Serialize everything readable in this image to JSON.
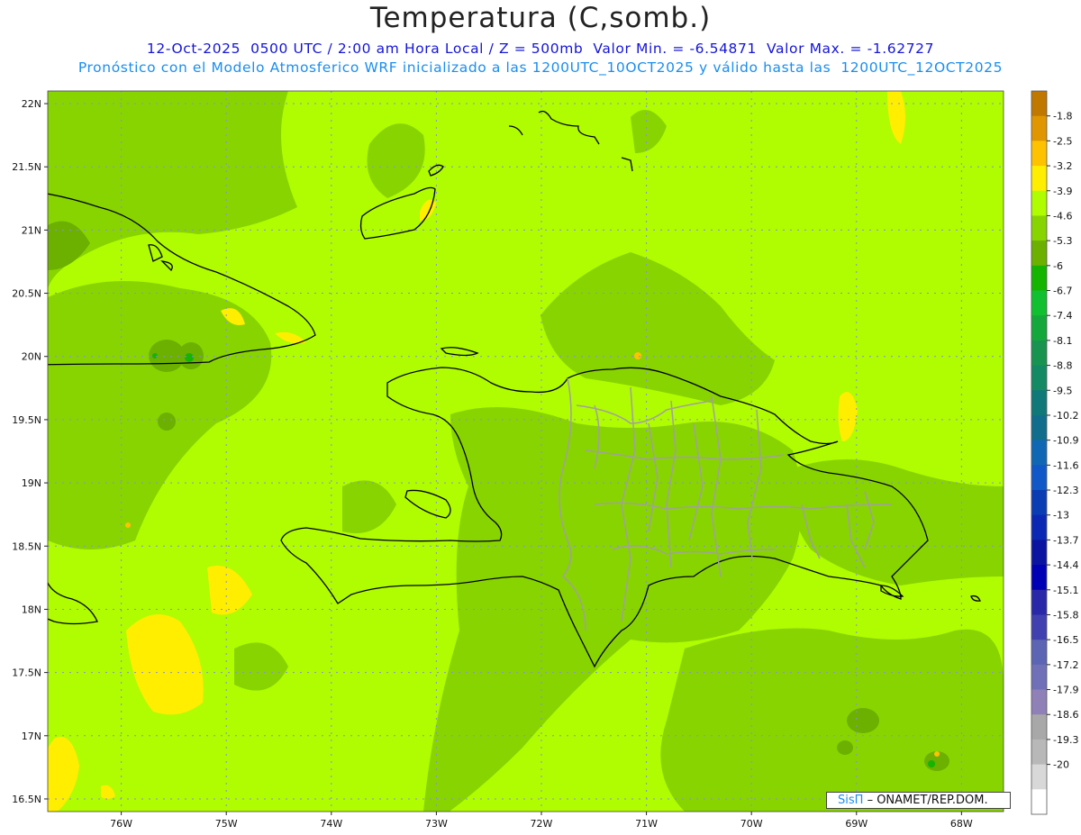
{
  "header": {
    "title": "Temperatura (C,somb.)",
    "line1": "12-Oct-2025  0500 UTC / 2:00 am Hora Local / Z = 500mb  Valor Min. = -6.54871  Valor Max. = -1.62727",
    "line2": "Pronóstico con el Modelo Atmosferico WRF inicializado a las 1200UTC_10OCT2025 y válido hasta las  1200UTC_12OCT2025"
  },
  "map": {
    "lat_labels": [
      "22N",
      "21.5N",
      "21N",
      "20.5N",
      "20N",
      "19.5N",
      "19N",
      "18.5N",
      "18N",
      "17.5N",
      "17N",
      "16.5N"
    ],
    "lon_labels": [
      "76W",
      "75W",
      "74W",
      "73W",
      "72W",
      "71W",
      "70W",
      "69W",
      "68W"
    ],
    "lat_range": [
      16.4,
      22.1
    ],
    "lon_range": [
      -76.7,
      -67.6
    ],
    "dominant_field_color": "#b0fc00",
    "coast_color": "#000000",
    "province_border_color": "#a0a0a0"
  },
  "colorbar": {
    "labels": [
      "-1.8",
      "-2.5",
      "-3.2",
      "-3.9",
      "-4.6",
      "-5.3",
      "-6",
      "-6.7",
      "-7.4",
      "-8.1",
      "-8.8",
      "-9.5",
      "-10.2",
      "-10.9",
      "-11.6",
      "-12.3",
      "-13",
      "-13.7",
      "-14.4",
      "-15.1",
      "-15.8",
      "-16.5",
      "-17.2",
      "-17.9",
      "-18.6",
      "-19.3",
      "-20"
    ],
    "colors": [
      "#c07800",
      "#e09600",
      "#ffc200",
      "#ffee00",
      "#b0fc00",
      "#88d400",
      "#6cb000",
      "#14b400",
      "#10c030",
      "#14a83c",
      "#189450",
      "#148a64",
      "#107878",
      "#106e8c",
      "#1068b4",
      "#1058c8",
      "#0a3cb4",
      "#0a28b4",
      "#0a14a0",
      "#0000b4",
      "#2828a8",
      "#4040b0",
      "#5c64b4",
      "#7070b8",
      "#9080b8",
      "#a8a8a8",
      "#b8b8b8",
      "#d8d8d8",
      "#ffffff"
    ]
  },
  "credit": {
    "brand": "SisΠ",
    "text": "– ONAMET/REP.DOM."
  }
}
